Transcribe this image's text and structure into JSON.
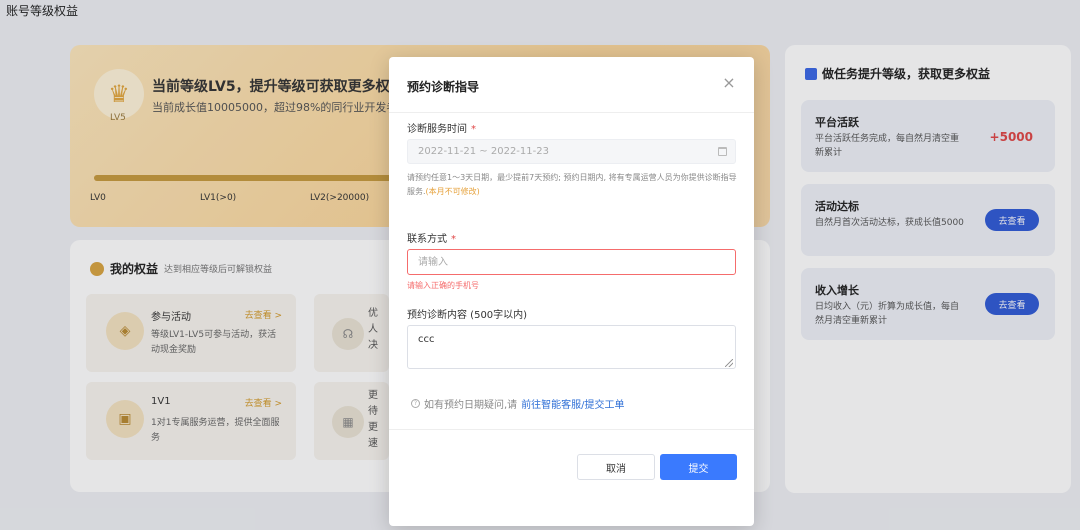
{
  "page": {
    "title": "账号等级权益"
  },
  "level": {
    "badge": "LV5",
    "title": "当前等级LV5，提升等级可获取更多权益",
    "subtitle": "当前成长值10005000，超过98%的同行业开发者。",
    "progress_fraction": 1.0,
    "levels": [
      "LV0",
      "LV1(>0)",
      "LV2(>20000)"
    ]
  },
  "rights": {
    "title": "我的权益",
    "subtitle": "达到相应等级后可解锁权益",
    "cards": [
      {
        "name": "参与活动",
        "link": "去查看 >",
        "desc": "等级LV1-LV5可参与活动，获活动现金奖励"
      },
      {
        "name": "1V1",
        "link": "去查看 >",
        "desc": "1对1专属服务运营，提供全面服务"
      }
    ],
    "partial_cards": [
      {
        "text": "优\n人\n决"
      },
      {
        "text": "更\n待\n更\n速"
      }
    ]
  },
  "tasks": {
    "title": "做任务提升等级，获取更多权益",
    "items": [
      {
        "name": "平台活跃",
        "desc": "平台活跃任务完成，每自然月清空重新累计",
        "points": "+5000"
      },
      {
        "name": "活动达标",
        "desc": "自然月首次活动达标，获成长值5000",
        "button": "去查看"
      },
      {
        "name": "收入增长",
        "desc": "日均收入（元）折算为成长值，每自然月清空重新累计",
        "button": "去查看"
      }
    ]
  },
  "modal": {
    "title": "预约诊断指导",
    "close": "×",
    "date_label": "诊断服务时间",
    "required_mark": "*",
    "date_value": "2022-11-21 ~ 2022-11-23",
    "hint": "请预约任意1～3天日期，最少提前7天预约; 预约日期内, 将有专属运营人员为你提供诊断指导服务.",
    "hint_warn": "(本月不可修改)",
    "contact_label": "联系方式",
    "contact_placeholder": "请输入",
    "contact_error": "请输入正确的手机号",
    "content_label": "预约诊断内容 (500字以内)",
    "content_value": "ccc",
    "help_text": "如有预约日期疑问,请",
    "help_link": "前往智能客服/提交工单",
    "cancel": "取消",
    "submit": "提交"
  }
}
